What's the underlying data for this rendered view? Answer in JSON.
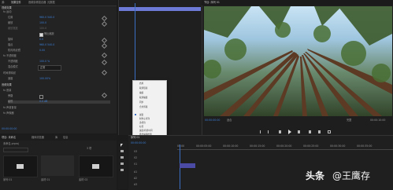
{
  "effect_controls": {
    "tabs": [
      "源:",
      "效果控件",
      "音频剪辑混合器",
      "元数据"
    ],
    "sections": [
      "视频效果",
      "运动",
      "不透明度",
      "时间重映射",
      "音频效果"
    ],
    "rows": [
      {
        "label": "fx 运动",
        "value": ""
      },
      {
        "label": "位置",
        "value": "960.0   540.0"
      },
      {
        "label": "缩放",
        "value": "100.0"
      },
      {
        "label": "缩放宽度",
        "value": "100.0"
      },
      {
        "label": "等比缩放",
        "value": ""
      },
      {
        "label": "旋转",
        "value": "0.0"
      },
      {
        "label": "锚点",
        "value": "960.0   540.0"
      },
      {
        "label": "防闪烁滤镜",
        "value": "0.00"
      },
      {
        "label": "fx 不透明度",
        "value": ""
      },
      {
        "label": "不透明度",
        "value": "100.0 %"
      },
      {
        "label": "混合模式",
        "value": "正常"
      },
      {
        "label": "时间重映射",
        "value": ""
      },
      {
        "label": "速度",
        "value": "100.00%"
      },
      {
        "label": "音频效果",
        "value": ""
      },
      {
        "label": "fx 音量",
        "value": ""
      },
      {
        "label": "旁路",
        "value": ""
      },
      {
        "label": "级别",
        "value": "0.0 dB"
      },
      {
        "label": "fx 声道音量",
        "value": ""
      },
      {
        "label": "fx 声像器",
        "value": ""
      }
    ],
    "timecode": "00:00:00:00"
  },
  "project_panel": {
    "tabs": [
      "项目: 未命名",
      "媒体浏览器",
      "库",
      "信息"
    ],
    "path": "未命名.prproj",
    "items": [
      "序列 01",
      "素材 01",
      "素材 02"
    ],
    "count": "3 项"
  },
  "context_menu": {
    "items": [
      "启用",
      "取消链接",
      "编组",
      "取消编组",
      "同步",
      "合并剪辑",
      "嵌套",
      "制作子序列",
      "多机位",
      "标签",
      "速度/持续时间",
      "场景编辑检测",
      "音频增益",
      "帧定格选项",
      "添加帧定格",
      "插入帧定格分段",
      "场选项",
      "时间插值",
      "缩放为帧大小",
      "设为帧大小",
      "调整图层",
      "链接媒体",
      "设为脱机",
      "重命名",
      "在项目中显示",
      "属性"
    ],
    "checked_item": "启用",
    "highlighted_item": "属性"
  },
  "program_monitor": {
    "tab": "节目: 序列 01",
    "timecode": "00:00:00:00",
    "fit": "适合",
    "scale": "完整",
    "duration": "00:00:10:00"
  },
  "timeline": {
    "tab": "序列 01",
    "timecode": "00:00:00:00",
    "ruler": [
      "00:00",
      "00:00:05:00",
      "00:00:10:00",
      "00:00:15:00",
      "00:00:20:00",
      "00:00:25:00",
      "00:00:30:00",
      "00:00:35:00"
    ],
    "tracks": [
      "V3",
      "V2",
      "V1",
      "A1",
      "A2",
      "A3"
    ]
  },
  "watermark": {
    "brand": "头条",
    "at": "@王鹰存"
  }
}
